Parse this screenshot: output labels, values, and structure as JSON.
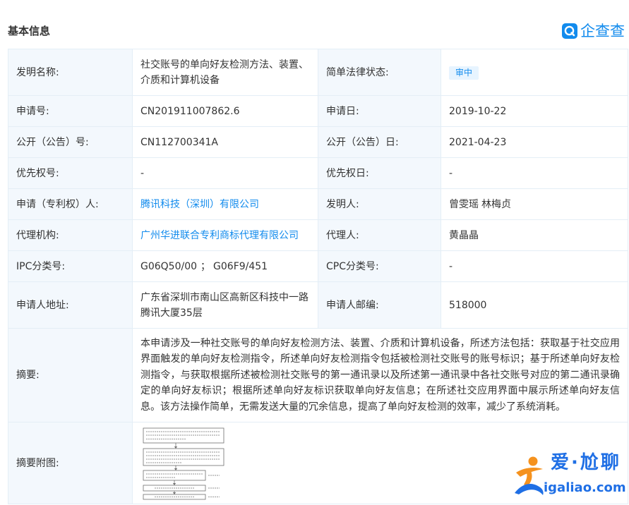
{
  "header": {
    "title": "基本信息"
  },
  "brand": {
    "logo_text": "企查查"
  },
  "icons": {
    "brand": "qichacha-logo-icon",
    "watermark": "igaliao-mascot-icon"
  },
  "colors": {
    "accent": "#128bed",
    "text": "#333333",
    "label-bg": "#f3f8fd",
    "border": "#e4eef6",
    "badge-bg": "#e7f4ff",
    "watermark-blue": "#1f6fe5",
    "watermark-orange": "#f5921e"
  },
  "patent": {
    "invention_name": {
      "label": "发明名称:",
      "value": "社交账号的单向好友检测方法、装置、介质和计算机设备"
    },
    "legal_status": {
      "label": "简单法律状态:",
      "value": "审中"
    },
    "application_number": {
      "label": "申请号:",
      "value": "CN201911007862.6"
    },
    "application_date": {
      "label": "申请日:",
      "value": "2019-10-22"
    },
    "publication_number": {
      "label": "公开（公告）号:",
      "value": "CN112700341A"
    },
    "publication_date": {
      "label": "公开（公告）日:",
      "value": "2021-04-23"
    },
    "priority_number": {
      "label": "优先权号:",
      "value": "-"
    },
    "priority_date": {
      "label": "优先权日:",
      "value": "-"
    },
    "applicant": {
      "label": "申请（专利权）人:",
      "value": "腾讯科技（深圳）有限公司"
    },
    "inventors": {
      "label": "发明人:",
      "values": [
        "曾雯瑶",
        "林梅贞"
      ]
    },
    "agency": {
      "label": "代理机构:",
      "value": "广州华进联合专利商标代理有限公司"
    },
    "agent": {
      "label": "代理人:",
      "value": "黄晶晶"
    },
    "ipc": {
      "label": "IPC分类号:",
      "codes": [
        "G06Q50/00",
        "G06F9/451"
      ],
      "separator": "；"
    },
    "cpc": {
      "label": "CPC分类号:",
      "value": "-"
    },
    "applicant_address": {
      "label": "申请人地址:",
      "value": "广东省深圳市南山区高新区科技中一路腾讯大厦35层"
    },
    "applicant_postcode": {
      "label": "申请人邮编:",
      "value": "518000"
    },
    "abstract": {
      "label": "摘要:",
      "value": "本申请涉及一种社交账号的单向好友检测方法、装置、介质和计算机设备，所述方法包括：获取基于社交应用界面触发的单向好友检测指令，所述单向好友检测指令包括被检测社交账号的账号标识；基于所述单向好友检测指令，与获取根据所述被检测社交账号的第一通讯录以及所述第一通讯录中各社交账号对应的第二通讯录确定的单向好友标识；根据所述单向好友标识获取单向好友信息；在所述社交应用界面中展示所述单向好友信息。该方法操作简单，无需发送大量的冗余信息，提高了单向好友检测的效率，减少了系统消耗。"
    },
    "abstract_figure": {
      "label": "摘要附图:"
    }
  },
  "watermark": {
    "name": "爱·尬聊",
    "domain": "igaliao.com"
  }
}
